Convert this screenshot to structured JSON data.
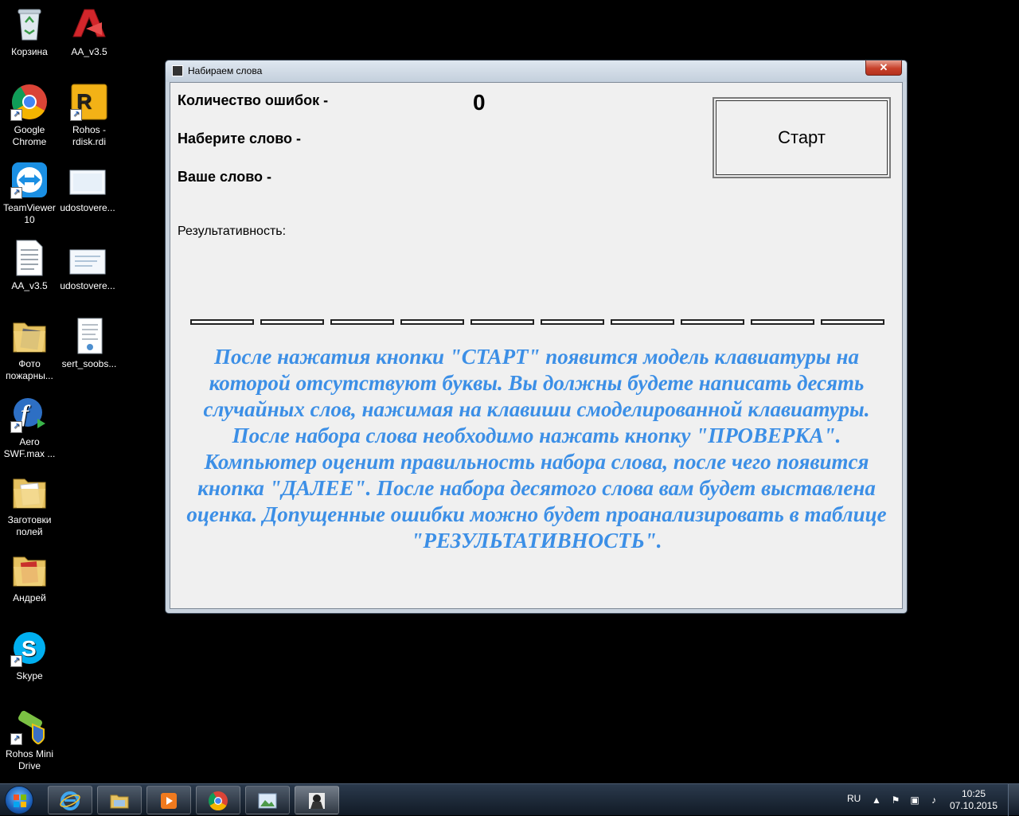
{
  "desktop": {
    "icons": [
      {
        "label": "Корзина",
        "icon": "recycle-bin-icon"
      },
      {
        "label": "AA_v3.5",
        "icon": "ammyy-admin-icon"
      },
      {
        "label": "Google Chrome",
        "icon": "chrome-icon"
      },
      {
        "label": "Rohos - rdisk.rdi",
        "icon": "rohos-disk-icon"
      },
      {
        "label": "TeamViewer 10",
        "icon": "teamviewer-icon"
      },
      {
        "label": "udostovere...",
        "icon": "document-thumbnail-icon"
      },
      {
        "label": "AA_v3.5",
        "icon": "text-file-icon"
      },
      {
        "label": "udostovere...",
        "icon": "document-thumbnail-icon"
      },
      {
        "label": "Фото пожарны...",
        "icon": "folder-icon"
      },
      {
        "label": "sert_soobs...",
        "icon": "certificate-file-icon"
      },
      {
        "label": "Aero SWF.max ...",
        "icon": "flash-icon"
      },
      {
        "label": "Заготовки полей",
        "icon": "folder-icon"
      },
      {
        "label": "Андрей",
        "icon": "folder-icon"
      },
      {
        "label": "Skype",
        "icon": "skype-icon"
      },
      {
        "label": "Rohos Mini Drive",
        "icon": "rohos-mini-drive-icon"
      }
    ]
  },
  "window": {
    "title": "Набираем слова",
    "close_symbol": "✕",
    "errors_label": "Количество ошибок -",
    "errors_value": "0",
    "type_word_label": "Наберите слово -",
    "your_word_label": "Ваше слово -",
    "start_button": "Старт",
    "results_label": "Результативность:",
    "progress_cells": 10,
    "instructions": "После нажатия кнопки \"СТАРТ\" появится модель клавиатуры на которой отсутствуют буквы. Вы должны будете написать десять случайных слов, нажимая на клавиши смоделированной клавиатуры. После набора слова необходимо нажать кнопку \"ПРОВЕРКА\". Компьютер оценит правильность набора слова, после чего появится кнопка \"ДАЛЕЕ\". После набора десятого слова вам будет выставлена оценка. Допущенные ошибки можно будет проанализировать в таблице \"РЕЗУЛЬТАТИВНОСТЬ\".",
    "instructions_color": "#3c8fe6"
  },
  "taskbar": {
    "pinned": [
      {
        "name": "ie-icon"
      },
      {
        "name": "explorer-icon"
      },
      {
        "name": "media-player-icon"
      },
      {
        "name": "chrome-icon"
      },
      {
        "name": "photo-viewer-icon"
      },
      {
        "name": "typing-app-icon",
        "active": true
      }
    ],
    "language": "RU",
    "time": "10:25",
    "date": "07.10.2015"
  }
}
